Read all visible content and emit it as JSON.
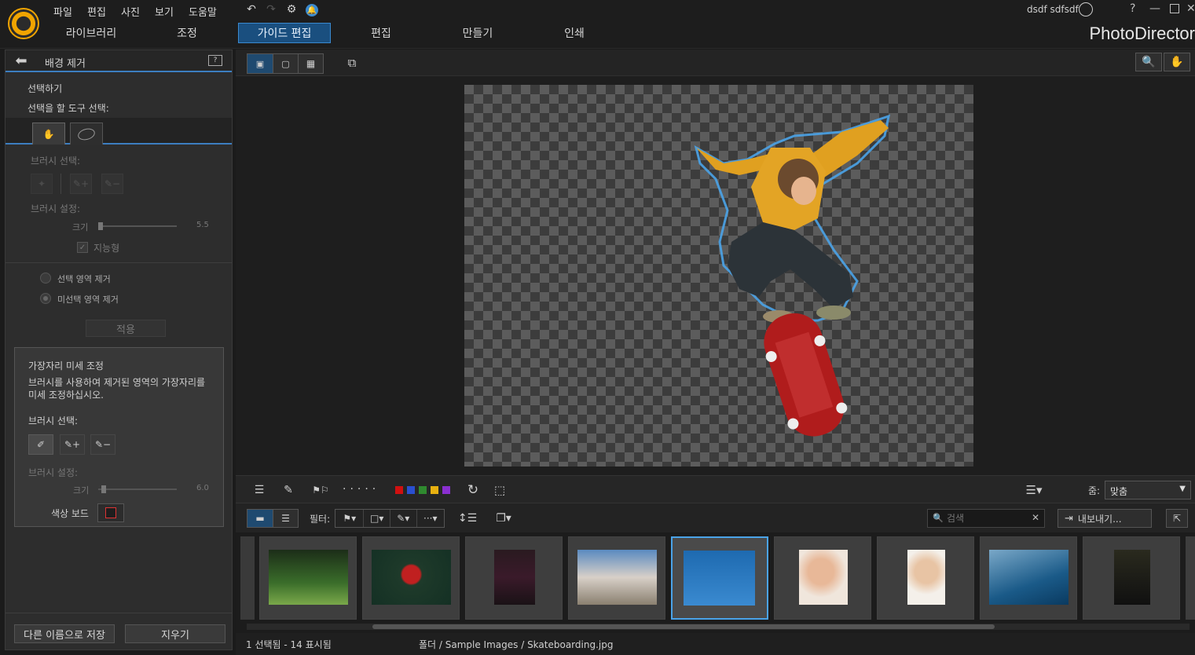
{
  "menu": [
    "파일",
    "편집",
    "사진",
    "보기",
    "도움말"
  ],
  "user": "dsdf sdfsdf",
  "help": "?",
  "tabs_left": [
    "라이브러리",
    "조정"
  ],
  "tabs_main": [
    "가이드 편집",
    "편집",
    "만들기",
    "인쇄"
  ],
  "brand": "PhotoDirector",
  "panel": {
    "title": "배경 제거",
    "select_heading": "선택하기",
    "select_tool_label": "선택을 할 도구 선택:",
    "brush_select": "브러시 선택:",
    "brush_settings": "브러시 설정:",
    "size_label": "크기",
    "size_value": "5.5",
    "smart_label": "지능형",
    "remove_selected": "선택 영역 제거",
    "remove_unselected": "미선택 영역 제거",
    "apply": "적용",
    "refine_heading": "가장자리 미세 조정",
    "refine_desc": "브러시를 사용하여 제거된 영역의 가장자리를 미세 조정하십시오.",
    "brush_select2": "브러시 선택:",
    "brush_settings2": "브러시 설정:",
    "size_label2": "크기",
    "size_value2": "6.0",
    "color_board": "색상 보드",
    "save_as": "다른 이름으로 저장",
    "clear": "지우기"
  },
  "toolbar": {
    "zoom_label": "줌:",
    "zoom_value": "맞춤",
    "color_labels": [
      "#d01010",
      "#2a4fd0",
      "#2f8a2f",
      "#e8b010",
      "#8a2fd0"
    ]
  },
  "filter": {
    "label": "필터:",
    "search_placeholder": "검색",
    "export": "내보내기..."
  },
  "status": {
    "count": "1 선택됨 - 14 표시됨",
    "path": "폴더 / Sample Images / Skateboarding.jpg"
  }
}
